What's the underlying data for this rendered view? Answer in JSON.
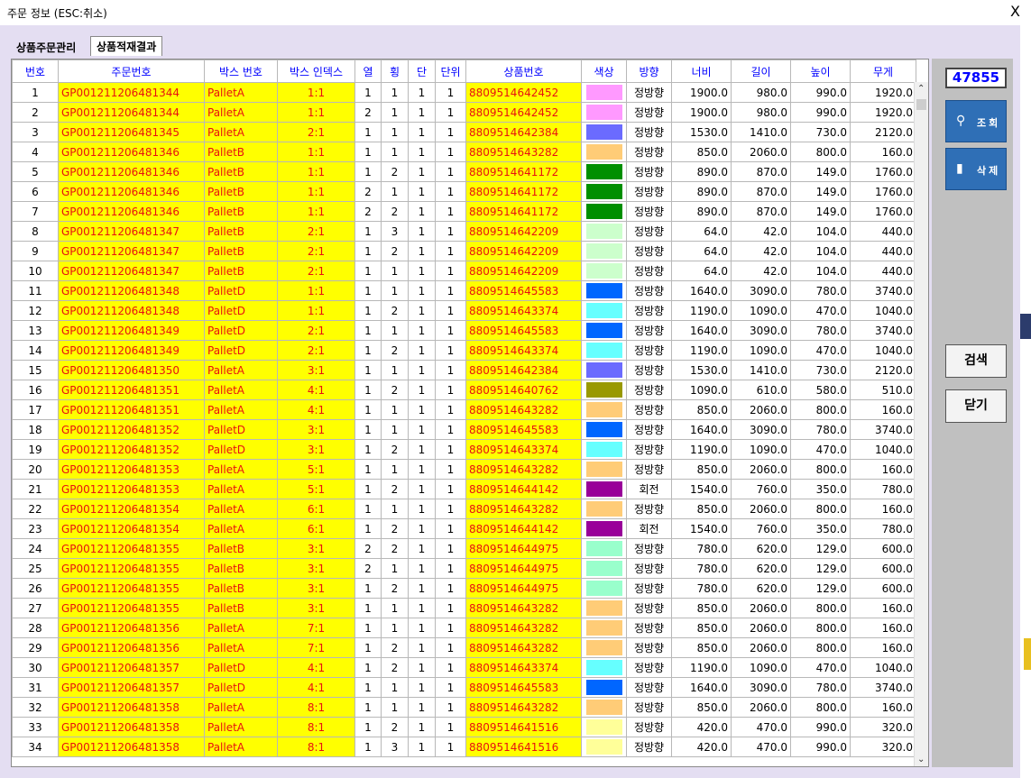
{
  "window": {
    "title": "주문 정보 (ESC:취소)",
    "close_label": "X"
  },
  "tabs": [
    {
      "label": "상품주문관리"
    },
    {
      "label": "상품적재결과"
    }
  ],
  "columns": [
    "번호",
    "주문번호",
    "박스 번호",
    "박스 인덱스",
    "열",
    "횡",
    "단",
    "단위",
    "상품번호",
    "색상",
    "방향",
    "너비",
    "길이",
    "높이",
    "무게"
  ],
  "rows": [
    {
      "no": "1",
      "order": "GP001211206481344",
      "box": "PalletA",
      "idx": "1:1",
      "r": "1",
      "h": "1",
      "d": "1",
      "u": "1",
      "prod": "8809514642452",
      "color": "#ff99ff",
      "dir": "정방향",
      "w": "1900.0",
      "l": "980.0",
      "ht": "990.0",
      "wt": "1920.0"
    },
    {
      "no": "2",
      "order": "GP001211206481344",
      "box": "PalletA",
      "idx": "1:1",
      "r": "2",
      "h": "1",
      "d": "1",
      "u": "1",
      "prod": "8809514642452",
      "color": "#ff99ff",
      "dir": "정방향",
      "w": "1900.0",
      "l": "980.0",
      "ht": "990.0",
      "wt": "1920.0"
    },
    {
      "no": "3",
      "order": "GP001211206481345",
      "box": "PalletA",
      "idx": "2:1",
      "r": "1",
      "h": "1",
      "d": "1",
      "u": "1",
      "prod": "8809514642384",
      "color": "#6b6bff",
      "dir": "정방향",
      "w": "1530.0",
      "l": "1410.0",
      "ht": "730.0",
      "wt": "2120.0"
    },
    {
      "no": "4",
      "order": "GP001211206481346",
      "box": "PalletB",
      "idx": "1:1",
      "r": "1",
      "h": "1",
      "d": "1",
      "u": "1",
      "prod": "8809514643282",
      "color": "#ffcc77",
      "dir": "정방향",
      "w": "850.0",
      "l": "2060.0",
      "ht": "800.0",
      "wt": "160.0"
    },
    {
      "no": "5",
      "order": "GP001211206481346",
      "box": "PalletB",
      "idx": "1:1",
      "r": "1",
      "h": "2",
      "d": "1",
      "u": "1",
      "prod": "8809514641172",
      "color": "#008f00",
      "dir": "정방향",
      "w": "890.0",
      "l": "870.0",
      "ht": "149.0",
      "wt": "1760.0"
    },
    {
      "no": "6",
      "order": "GP001211206481346",
      "box": "PalletB",
      "idx": "1:1",
      "r": "2",
      "h": "1",
      "d": "1",
      "u": "1",
      "prod": "8809514641172",
      "color": "#008f00",
      "dir": "정방향",
      "w": "890.0",
      "l": "870.0",
      "ht": "149.0",
      "wt": "1760.0"
    },
    {
      "no": "7",
      "order": "GP001211206481346",
      "box": "PalletB",
      "idx": "1:1",
      "r": "2",
      "h": "2",
      "d": "1",
      "u": "1",
      "prod": "8809514641172",
      "color": "#008f00",
      "dir": "정방향",
      "w": "890.0",
      "l": "870.0",
      "ht": "149.0",
      "wt": "1760.0"
    },
    {
      "no": "8",
      "order": "GP001211206481347",
      "box": "PalletB",
      "idx": "2:1",
      "r": "1",
      "h": "3",
      "d": "1",
      "u": "1",
      "prod": "8809514642209",
      "color": "#ccffcc",
      "dir": "정방향",
      "w": "64.0",
      "l": "42.0",
      "ht": "104.0",
      "wt": "440.0"
    },
    {
      "no": "9",
      "order": "GP001211206481347",
      "box": "PalletB",
      "idx": "2:1",
      "r": "1",
      "h": "2",
      "d": "1",
      "u": "1",
      "prod": "8809514642209",
      "color": "#ccffcc",
      "dir": "정방향",
      "w": "64.0",
      "l": "42.0",
      "ht": "104.0",
      "wt": "440.0"
    },
    {
      "no": "10",
      "order": "GP001211206481347",
      "box": "PalletB",
      "idx": "2:1",
      "r": "1",
      "h": "1",
      "d": "1",
      "u": "1",
      "prod": "8809514642209",
      "color": "#ccffcc",
      "dir": "정방향",
      "w": "64.0",
      "l": "42.0",
      "ht": "104.0",
      "wt": "440.0"
    },
    {
      "no": "11",
      "order": "GP001211206481348",
      "box": "PalletD",
      "idx": "1:1",
      "r": "1",
      "h": "1",
      "d": "1",
      "u": "1",
      "prod": "8809514645583",
      "color": "#0066ff",
      "dir": "정방향",
      "w": "1640.0",
      "l": "3090.0",
      "ht": "780.0",
      "wt": "3740.0"
    },
    {
      "no": "12",
      "order": "GP001211206481348",
      "box": "PalletD",
      "idx": "1:1",
      "r": "1",
      "h": "2",
      "d": "1",
      "u": "1",
      "prod": "8809514643374",
      "color": "#66ffff",
      "dir": "정방향",
      "w": "1190.0",
      "l": "1090.0",
      "ht": "470.0",
      "wt": "1040.0"
    },
    {
      "no": "13",
      "order": "GP001211206481349",
      "box": "PalletD",
      "idx": "2:1",
      "r": "1",
      "h": "1",
      "d": "1",
      "u": "1",
      "prod": "8809514645583",
      "color": "#0066ff",
      "dir": "정방향",
      "w": "1640.0",
      "l": "3090.0",
      "ht": "780.0",
      "wt": "3740.0"
    },
    {
      "no": "14",
      "order": "GP001211206481349",
      "box": "PalletD",
      "idx": "2:1",
      "r": "1",
      "h": "2",
      "d": "1",
      "u": "1",
      "prod": "8809514643374",
      "color": "#66ffff",
      "dir": "정방향",
      "w": "1190.0",
      "l": "1090.0",
      "ht": "470.0",
      "wt": "1040.0"
    },
    {
      "no": "15",
      "order": "GP001211206481350",
      "box": "PalletA",
      "idx": "3:1",
      "r": "1",
      "h": "1",
      "d": "1",
      "u": "1",
      "prod": "8809514642384",
      "color": "#6b6bff",
      "dir": "정방향",
      "w": "1530.0",
      "l": "1410.0",
      "ht": "730.0",
      "wt": "2120.0"
    },
    {
      "no": "16",
      "order": "GP001211206481351",
      "box": "PalletA",
      "idx": "4:1",
      "r": "1",
      "h": "2",
      "d": "1",
      "u": "1",
      "prod": "8809514640762",
      "color": "#999900",
      "dir": "정방향",
      "w": "1090.0",
      "l": "610.0",
      "ht": "580.0",
      "wt": "510.0"
    },
    {
      "no": "17",
      "order": "GP001211206481351",
      "box": "PalletA",
      "idx": "4:1",
      "r": "1",
      "h": "1",
      "d": "1",
      "u": "1",
      "prod": "8809514643282",
      "color": "#ffcc77",
      "dir": "정방향",
      "w": "850.0",
      "l": "2060.0",
      "ht": "800.0",
      "wt": "160.0"
    },
    {
      "no": "18",
      "order": "GP001211206481352",
      "box": "PalletD",
      "idx": "3:1",
      "r": "1",
      "h": "1",
      "d": "1",
      "u": "1",
      "prod": "8809514645583",
      "color": "#0066ff",
      "dir": "정방향",
      "w": "1640.0",
      "l": "3090.0",
      "ht": "780.0",
      "wt": "3740.0"
    },
    {
      "no": "19",
      "order": "GP001211206481352",
      "box": "PalletD",
      "idx": "3:1",
      "r": "1",
      "h": "2",
      "d": "1",
      "u": "1",
      "prod": "8809514643374",
      "color": "#66ffff",
      "dir": "정방향",
      "w": "1190.0",
      "l": "1090.0",
      "ht": "470.0",
      "wt": "1040.0"
    },
    {
      "no": "20",
      "order": "GP001211206481353",
      "box": "PalletA",
      "idx": "5:1",
      "r": "1",
      "h": "1",
      "d": "1",
      "u": "1",
      "prod": "8809514643282",
      "color": "#ffcc77",
      "dir": "정방향",
      "w": "850.0",
      "l": "2060.0",
      "ht": "800.0",
      "wt": "160.0"
    },
    {
      "no": "21",
      "order": "GP001211206481353",
      "box": "PalletA",
      "idx": "5:1",
      "r": "1",
      "h": "2",
      "d": "1",
      "u": "1",
      "prod": "8809514644142",
      "color": "#990099",
      "dir": "회전",
      "w": "1540.0",
      "l": "760.0",
      "ht": "350.0",
      "wt": "780.0"
    },
    {
      "no": "22",
      "order": "GP001211206481354",
      "box": "PalletA",
      "idx": "6:1",
      "r": "1",
      "h": "1",
      "d": "1",
      "u": "1",
      "prod": "8809514643282",
      "color": "#ffcc77",
      "dir": "정방향",
      "w": "850.0",
      "l": "2060.0",
      "ht": "800.0",
      "wt": "160.0"
    },
    {
      "no": "23",
      "order": "GP001211206481354",
      "box": "PalletA",
      "idx": "6:1",
      "r": "1",
      "h": "2",
      "d": "1",
      "u": "1",
      "prod": "8809514644142",
      "color": "#990099",
      "dir": "회전",
      "w": "1540.0",
      "l": "760.0",
      "ht": "350.0",
      "wt": "780.0"
    },
    {
      "no": "24",
      "order": "GP001211206481355",
      "box": "PalletB",
      "idx": "3:1",
      "r": "2",
      "h": "2",
      "d": "1",
      "u": "1",
      "prod": "8809514644975",
      "color": "#99ffcc",
      "dir": "정방향",
      "w": "780.0",
      "l": "620.0",
      "ht": "129.0",
      "wt": "600.0"
    },
    {
      "no": "25",
      "order": "GP001211206481355",
      "box": "PalletB",
      "idx": "3:1",
      "r": "2",
      "h": "1",
      "d": "1",
      "u": "1",
      "prod": "8809514644975",
      "color": "#99ffcc",
      "dir": "정방향",
      "w": "780.0",
      "l": "620.0",
      "ht": "129.0",
      "wt": "600.0"
    },
    {
      "no": "26",
      "order": "GP001211206481355",
      "box": "PalletB",
      "idx": "3:1",
      "r": "1",
      "h": "2",
      "d": "1",
      "u": "1",
      "prod": "8809514644975",
      "color": "#99ffcc",
      "dir": "정방향",
      "w": "780.0",
      "l": "620.0",
      "ht": "129.0",
      "wt": "600.0"
    },
    {
      "no": "27",
      "order": "GP001211206481355",
      "box": "PalletB",
      "idx": "3:1",
      "r": "1",
      "h": "1",
      "d": "1",
      "u": "1",
      "prod": "8809514643282",
      "color": "#ffcc77",
      "dir": "정방향",
      "w": "850.0",
      "l": "2060.0",
      "ht": "800.0",
      "wt": "160.0"
    },
    {
      "no": "28",
      "order": "GP001211206481356",
      "box": "PalletA",
      "idx": "7:1",
      "r": "1",
      "h": "1",
      "d": "1",
      "u": "1",
      "prod": "8809514643282",
      "color": "#ffcc77",
      "dir": "정방향",
      "w": "850.0",
      "l": "2060.0",
      "ht": "800.0",
      "wt": "160.0"
    },
    {
      "no": "29",
      "order": "GP001211206481356",
      "box": "PalletA",
      "idx": "7:1",
      "r": "1",
      "h": "2",
      "d": "1",
      "u": "1",
      "prod": "8809514643282",
      "color": "#ffcc77",
      "dir": "정방향",
      "w": "850.0",
      "l": "2060.0",
      "ht": "800.0",
      "wt": "160.0"
    },
    {
      "no": "30",
      "order": "GP001211206481357",
      "box": "PalletD",
      "idx": "4:1",
      "r": "1",
      "h": "2",
      "d": "1",
      "u": "1",
      "prod": "8809514643374",
      "color": "#66ffff",
      "dir": "정방향",
      "w": "1190.0",
      "l": "1090.0",
      "ht": "470.0",
      "wt": "1040.0"
    },
    {
      "no": "31",
      "order": "GP001211206481357",
      "box": "PalletD",
      "idx": "4:1",
      "r": "1",
      "h": "1",
      "d": "1",
      "u": "1",
      "prod": "8809514645583",
      "color": "#0066ff",
      "dir": "정방향",
      "w": "1640.0",
      "l": "3090.0",
      "ht": "780.0",
      "wt": "3740.0"
    },
    {
      "no": "32",
      "order": "GP001211206481358",
      "box": "PalletA",
      "idx": "8:1",
      "r": "1",
      "h": "1",
      "d": "1",
      "u": "1",
      "prod": "8809514643282",
      "color": "#ffcc77",
      "dir": "정방향",
      "w": "850.0",
      "l": "2060.0",
      "ht": "800.0",
      "wt": "160.0"
    },
    {
      "no": "33",
      "order": "GP001211206481358",
      "box": "PalletA",
      "idx": "8:1",
      "r": "1",
      "h": "2",
      "d": "1",
      "u": "1",
      "prod": "8809514641516",
      "color": "#ffff99",
      "dir": "정방향",
      "w": "420.0",
      "l": "470.0",
      "ht": "990.0",
      "wt": "320.0"
    },
    {
      "no": "34",
      "order": "GP001211206481358",
      "box": "PalletA",
      "idx": "8:1",
      "r": "1",
      "h": "3",
      "d": "1",
      "u": "1",
      "prod": "8809514641516",
      "color": "#ffff99",
      "dir": "정방향",
      "w": "420.0",
      "l": "470.0",
      "ht": "990.0",
      "wt": "320.0"
    }
  ],
  "side": {
    "counter": "47855",
    "search_label": "조회",
    "search_icon": "search-icon",
    "delete_label": "삭제",
    "delete_icon": "trash-icon",
    "find_label": "검색",
    "close_label": "닫기"
  },
  "scroll": {
    "up": "⌃",
    "down": "⌄"
  }
}
